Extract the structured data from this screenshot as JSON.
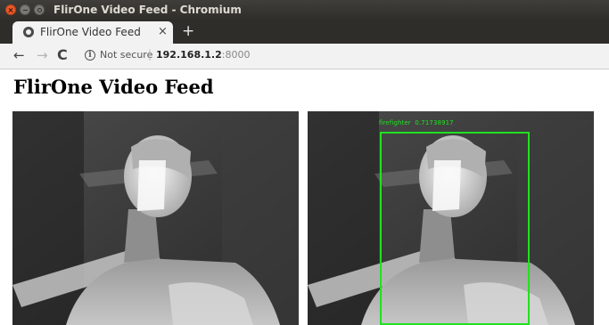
{
  "window": {
    "title": "FlirOne Video Feed - Chromium"
  },
  "tabs": [
    {
      "label": "FlirOne Video Feed",
      "close_glyph": "×"
    }
  ],
  "new_tab_glyph": "+",
  "toolbar": {
    "back_glyph": "←",
    "forward_glyph": "→",
    "reload_glyph": "C",
    "info_glyph": "i",
    "security_text": "Not secure",
    "separator": "|",
    "url_host": "192.168.1.2",
    "url_port": ":8000"
  },
  "page": {
    "heading": "FlirOne Video Feed",
    "feeds": [
      {
        "kind": "raw-thermal-image"
      },
      {
        "kind": "detection-thermal-image",
        "detection": {
          "label": "firefighter",
          "score": "0.71738917",
          "box_color": "#22e022"
        }
      }
    ]
  },
  "colors": {
    "titlebar": "#3a3935",
    "tabstrip": "#2e2d2a",
    "toolbar": "#f2f2f2",
    "close_button": "#e9592b"
  },
  "icons": [
    "close-icon",
    "minimize-icon",
    "maximize-icon",
    "globe-icon",
    "plus-icon",
    "arrow-left-icon",
    "arrow-right-icon",
    "reload-icon",
    "info-icon"
  ]
}
